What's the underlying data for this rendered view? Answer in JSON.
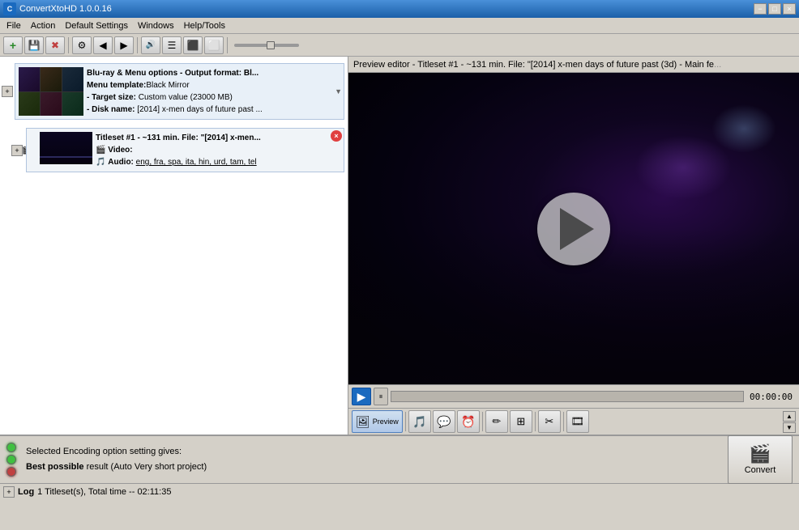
{
  "app": {
    "title": "ConvertXtoHD 1.0.0.16",
    "titlebar_buttons": [
      "−",
      "□",
      "×"
    ]
  },
  "menubar": {
    "items": [
      "File",
      "Action",
      "Default Settings",
      "Windows",
      "Help/Tools"
    ]
  },
  "toolbar": {
    "buttons": [
      "➕",
      "💾",
      "✖",
      "🔧",
      "◀",
      "▶",
      "🔊",
      "☰",
      "⬛",
      "⬜"
    ]
  },
  "left_panel": {
    "project": {
      "title": "Blu-ray & Menu options - Output format: Bl...",
      "menu_template_label": "Menu template:",
      "menu_template_value": "Black Mirror",
      "target_size_label": "Target size:",
      "target_size_value": "Custom value (23000 MB)",
      "disk_name_label": "Disk name:",
      "disk_name_value": "[2014] x-men days of future past ..."
    },
    "titleset": {
      "title": "Titleset #1 - ~131 min. File: \"[2014] x-men...",
      "video_label": "Video:",
      "audio_label": "Audio:",
      "audio_value": "eng, fra, spa, ita, hin, urd, tam, tel"
    }
  },
  "preview": {
    "header": "Preview editor - Titleset #1 - ~131 min. File: \"[2014] x-men days of future past (3d) - Main fe",
    "time": "00:00:00"
  },
  "preview_tools": [
    {
      "icon": "🎬",
      "label": "Preview",
      "active": true
    },
    {
      "icon": "🎵",
      "label": ""
    },
    {
      "icon": "💬",
      "label": ""
    },
    {
      "icon": "⏰",
      "label": ""
    },
    {
      "icon": "✂",
      "label": ""
    },
    {
      "icon": "🔲",
      "label": ""
    },
    {
      "icon": "✂",
      "label": ""
    },
    {
      "icon": "🎞",
      "label": ""
    }
  ],
  "statusbar": {
    "light1_color": "#40c040",
    "light2_color": "#40c040",
    "light3_color": "#c04040",
    "line1": "Selected Encoding option setting gives:",
    "line2_bold": "Best possible",
    "line2_rest": " result (Auto Very short project)",
    "convert_label": "Convert"
  },
  "logbar": {
    "label": "Log",
    "status": "1 Titleset(s), Total time -- 02:11:35"
  }
}
